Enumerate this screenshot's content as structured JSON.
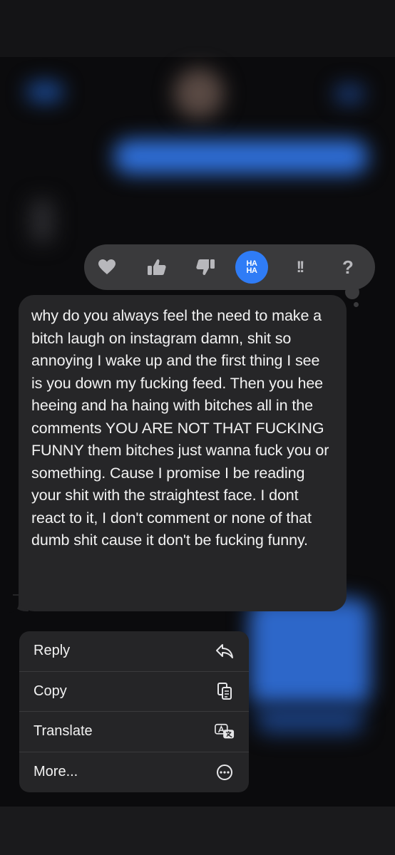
{
  "reactions": [
    {
      "name": "heart",
      "selected": false
    },
    {
      "name": "thumbs-up",
      "selected": false
    },
    {
      "name": "thumbs-down",
      "selected": false
    },
    {
      "name": "haha",
      "selected": true,
      "label_top": "HA",
      "label_bottom": "HA"
    },
    {
      "name": "emphasize",
      "selected": false,
      "label": "!!"
    },
    {
      "name": "question",
      "selected": false,
      "label": "?"
    }
  ],
  "message": {
    "text": "why do you always feel the need to make a bitch laugh on instagram damn, shit so annoying I wake up and the first thing I see is you down my fucking feed. Then you hee heeing and ha haing with bitches all in the comments YOU ARE NOT THAT FUCKING FUNNY them bitches just wanna fuck you or something. Cause I promise I be reading your shit with the straightest face. I dont react to it, I don't comment or none of that dumb shit cause it don't be fucking funny."
  },
  "menu": {
    "items": [
      {
        "label": "Reply",
        "icon": "reply-icon"
      },
      {
        "label": "Copy",
        "icon": "copy-icon"
      },
      {
        "label": "Translate",
        "icon": "translate-icon"
      },
      {
        "label": "More...",
        "icon": "more-icon"
      }
    ]
  },
  "colors": {
    "accent": "#2f7cf6",
    "background": "#0b0b0d",
    "bubble": "#262628",
    "reaction_bar": "#3a3a3c",
    "menu": "#252527"
  }
}
